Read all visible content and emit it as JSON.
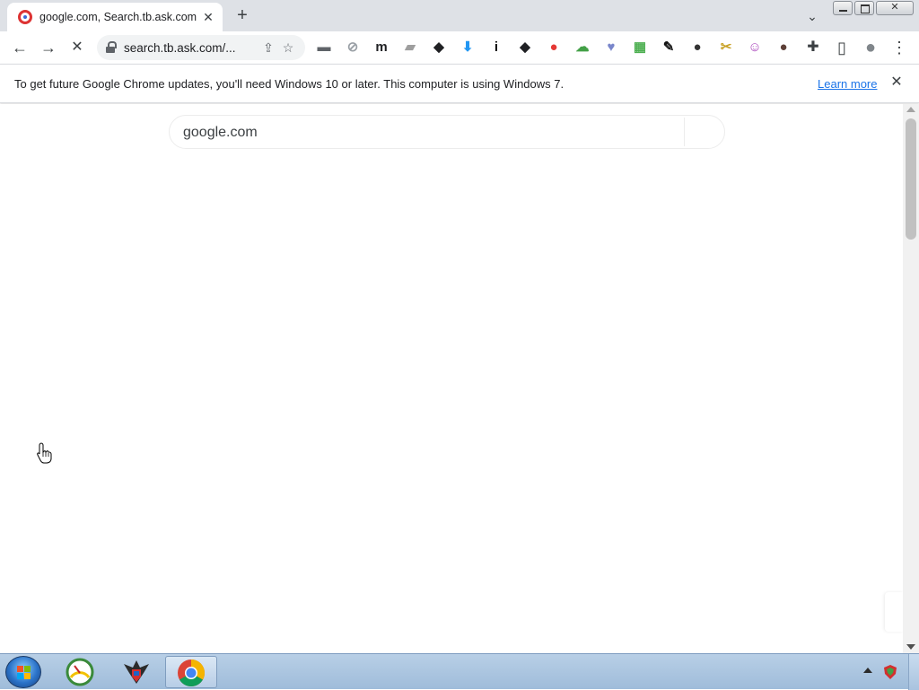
{
  "browser": {
    "tab": {
      "title": "google.com, Search.tb.ask.com",
      "close_glyph": "✕"
    },
    "new_tab_glyph": "+",
    "tab_search_glyph": "⌄",
    "nav": {
      "back_glyph": "←",
      "forward_glyph": "→",
      "stop_glyph": "✕"
    },
    "omnibox": {
      "url": "search.tb.ask.com/...",
      "share_glyph": "⇪",
      "star_glyph": "☆"
    },
    "extensions": [
      {
        "name": "folder-extension-icon",
        "glyph": "▬",
        "color": "#5f6368"
      },
      {
        "name": "compass-extension-icon",
        "glyph": "⊘",
        "color": "#9aa0a6"
      },
      {
        "name": "m-extension-icon",
        "glyph": "m",
        "color": "#202124"
      },
      {
        "name": "card-extension-icon",
        "glyph": "▰",
        "color": "#9e9e9e"
      },
      {
        "name": "shield-extension-icon",
        "glyph": "◆",
        "color": "#202124"
      },
      {
        "name": "download-extension-icon",
        "glyph": "⬇",
        "color": "#2196f3"
      },
      {
        "name": "info-extension-icon",
        "glyph": "i",
        "color": "#111111"
      },
      {
        "name": "graduation-cap-extension-icon",
        "glyph": "◆",
        "color": "#202124"
      },
      {
        "name": "video-record-extension-icon",
        "glyph": "●",
        "color": "#e53935"
      },
      {
        "name": "cloud-extension-icon",
        "glyph": "☁",
        "color": "#43a047"
      },
      {
        "name": "heart-extension-icon",
        "glyph": "♥",
        "color": "#7986cb"
      },
      {
        "name": "screenshot-extension-icon",
        "glyph": "▦",
        "color": "#4caf50"
      },
      {
        "name": "edit-box-extension-icon",
        "glyph": "✎",
        "color": "#111111"
      },
      {
        "name": "ninja-extension-icon",
        "glyph": "●",
        "color": "#333333"
      },
      {
        "name": "paint-extension-icon",
        "glyph": "✂",
        "color": "#c9a227"
      },
      {
        "name": "smiley-extension-icon",
        "glyph": "☺",
        "color": "#ab47bc"
      },
      {
        "name": "bear-extension-icon",
        "glyph": "●",
        "color": "#5d4037"
      }
    ],
    "toolbar_right": {
      "puzzle_glyph": "✚",
      "sidepanel_glyph": "▯",
      "profile_glyph": "●",
      "menu_glyph": "⋮"
    },
    "infobar": {
      "message": "To get future Google Chrome updates, you'll need Windows 10 or later. This computer is using Windows 7.",
      "link": "Learn more",
      "close_glyph": "✕"
    }
  },
  "page": {
    "search_value": "google.com"
  },
  "colors": {
    "tabstrip": "#dee1e6",
    "link": "#1a73e8",
    "taskbar": "#a9c3df"
  }
}
